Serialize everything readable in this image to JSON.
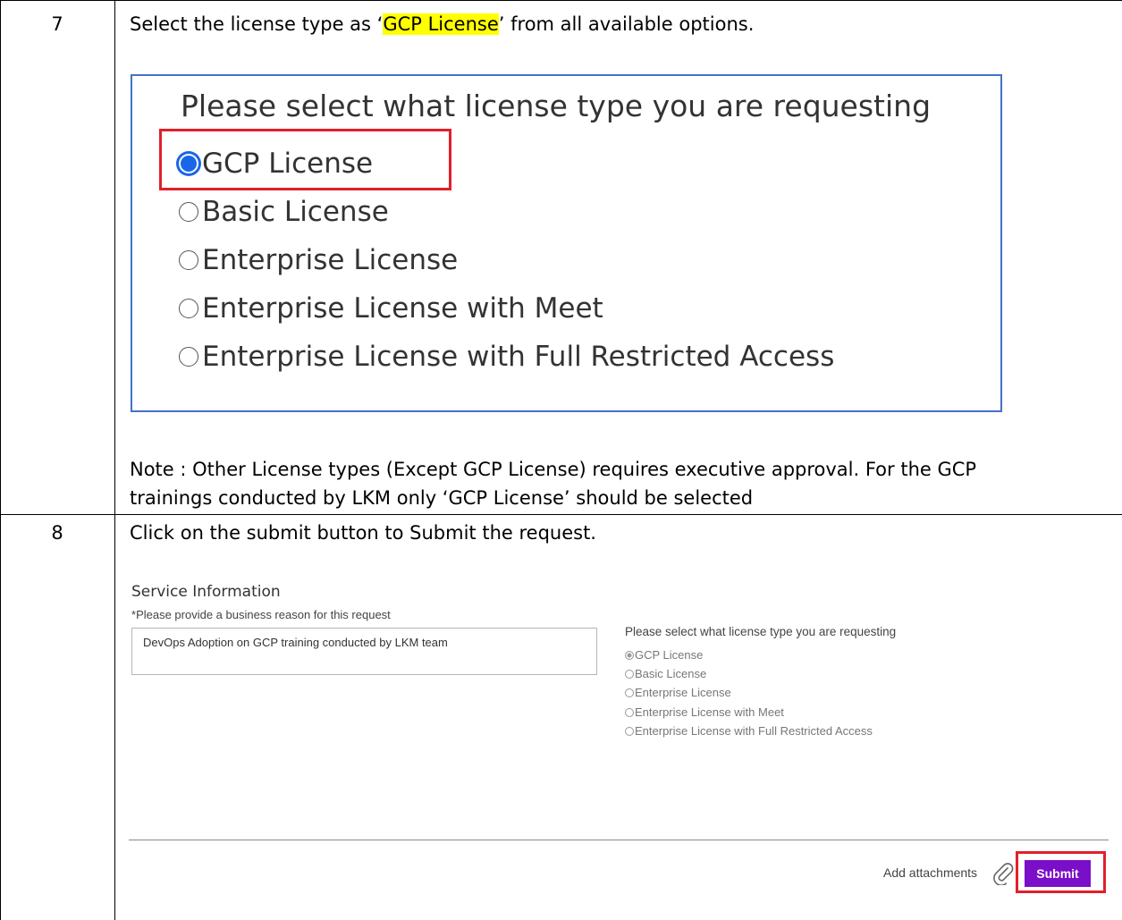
{
  "steps": [
    {
      "number": "7",
      "instruction_prefix": "Select the license type as ‘",
      "instruction_highlight": "GCP License",
      "instruction_suffix": "’ from all available options.",
      "zoom": {
        "question": "Please select what license type you are requesting",
        "options": [
          {
            "label": "GCP License",
            "selected": true
          },
          {
            "label": "Basic License",
            "selected": false
          },
          {
            "label": "Enterprise License",
            "selected": false
          },
          {
            "label": "Enterprise License with Meet",
            "selected": false
          },
          {
            "label": "Enterprise License with Full Restricted Access",
            "selected": false
          }
        ]
      },
      "note_line1": "Note : Other License types (Except GCP License) requires executive approval. For the GCP",
      "note_line2": "trainings conducted by LKM only ‘GCP License’ should be selected"
    },
    {
      "number": "8",
      "instruction": "Click on the submit button to Submit the request.",
      "form": {
        "section_title": "Service Information",
        "required_mark": "*",
        "reason_label": "Please provide a business reason for this request",
        "reason_value": "DevOps Adoption on GCP training conducted by LKM team",
        "question": "Please select what license type you are requesting",
        "options": [
          {
            "label": "GCP License",
            "selected": true
          },
          {
            "label": "Basic License",
            "selected": false
          },
          {
            "label": "Enterprise License",
            "selected": false
          },
          {
            "label": "Enterprise License with Meet",
            "selected": false
          },
          {
            "label": "Enterprise License with Full Restricted Access",
            "selected": false
          }
        ],
        "attach_label": "Add attachments",
        "submit_label": "Submit"
      }
    }
  ],
  "colors": {
    "highlight": "#ffff00",
    "callout_border": "#e0202a",
    "panel_border": "#4472c4",
    "submit_bg": "#7b0ec8"
  },
  "icons": [
    "paperclip-icon"
  ]
}
